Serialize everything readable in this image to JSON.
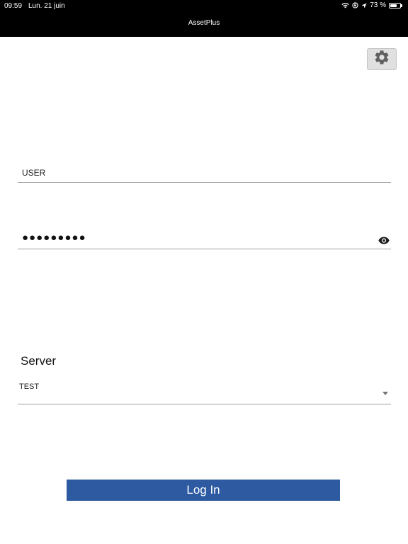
{
  "status_bar": {
    "time": "09:59",
    "date": "Lun. 21 juin",
    "battery_text": "73 %",
    "battery_level": 0.73,
    "icons": [
      "wifi-icon",
      "orientation-lock-icon",
      "location-arrow-icon",
      "battery-icon"
    ]
  },
  "header": {
    "title": "AssetPlus"
  },
  "settings": {
    "icon": "gear-icon"
  },
  "login_form": {
    "username_value": "USER",
    "password_value": "●●●●●●●●●",
    "password_toggle_icon": "eye-icon",
    "server_label": "Server",
    "server_selected": "TEST",
    "login_button_label": "Log In"
  },
  "colors": {
    "topbar_background": "#000000",
    "login_button": "#2d5aa0",
    "field_underline": "#9e9e9e",
    "settings_button": "#e0e0e0"
  }
}
